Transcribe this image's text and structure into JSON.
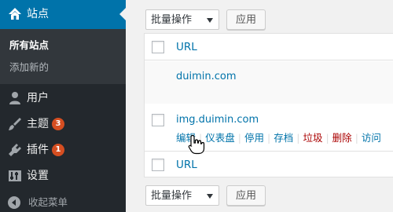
{
  "sidebar": {
    "header": {
      "label": "站点",
      "icon": "network-icon"
    },
    "submenu": {
      "active": "所有站点",
      "add_new": "添加新的"
    },
    "items": [
      {
        "label": "用户",
        "icon": "user-icon"
      },
      {
        "label": "主题",
        "icon": "brush-icon",
        "badge": "3"
      },
      {
        "label": "插件",
        "icon": "plugin-icon",
        "badge": "1"
      },
      {
        "label": "设置",
        "icon": "settings-icon"
      }
    ],
    "collapse": {
      "label": "收起菜单",
      "icon": "collapse-icon"
    }
  },
  "bulk_top": {
    "select_value": "批量操作",
    "apply_label": "应用"
  },
  "bulk_bottom": {
    "select_value": "批量操作",
    "apply_label": "应用"
  },
  "table": {
    "header_label": "URL",
    "footer_label": "URL",
    "rows": [
      {
        "url": "duimin.com"
      },
      {
        "url": "img.duimin.com",
        "actions": {
          "edit": "编辑",
          "dashboard": "仪表盘",
          "deactivate": "停用",
          "archive": "存档",
          "spam": "垃圾",
          "delete": "删除",
          "visit": "访问"
        }
      }
    ]
  },
  "colors": {
    "accent": "#0073aa",
    "sidebar": "#23282d",
    "badge": "#d54e21",
    "danger": "#aa0000"
  }
}
